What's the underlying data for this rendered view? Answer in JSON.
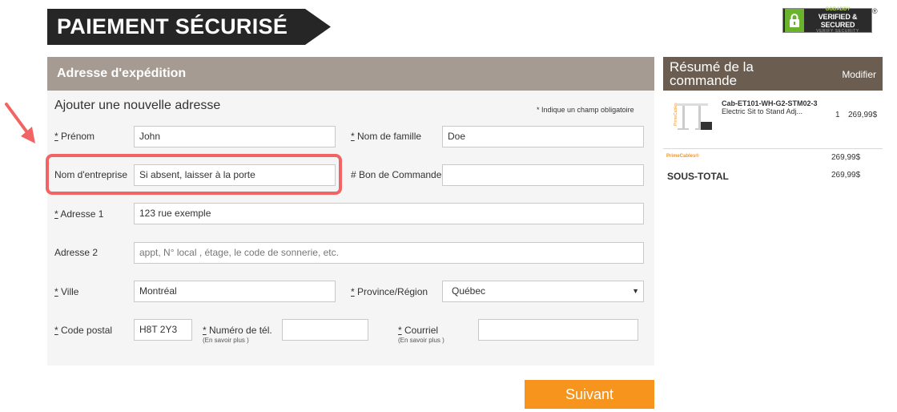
{
  "header": {
    "title": "PAIEMENT SÉCURISÉ",
    "badge": {
      "line1": "GODADDY",
      "line2": "VERIFIED & SECURED",
      "line3": "VERIFY SECURITY",
      "reg": "®"
    }
  },
  "shipping": {
    "heading": "Adresse d'expédition",
    "subtitle": "Ajouter une nouvelle adresse",
    "required_note": "* Indique un champ obligatoire",
    "fields": {
      "first_name": {
        "label": "Prénom",
        "value": "John"
      },
      "last_name": {
        "label": "Nom de famille",
        "value": "Doe"
      },
      "company": {
        "label": "Nom d'entreprise",
        "value": "Si absent, laisser à la porte"
      },
      "po_number": {
        "label": "# Bon de Commande",
        "value": ""
      },
      "address1": {
        "label": "Adresse 1",
        "value": "123 rue exemple"
      },
      "address2": {
        "label": "Adresse 2",
        "placeholder": "appt, N° local , étage, le code de sonnerie, etc."
      },
      "city": {
        "label": "Ville",
        "value": "Montréal"
      },
      "province": {
        "label": "Province/Région",
        "value": "Québec"
      },
      "postal": {
        "label": "Code postal",
        "value": "H8T 2Y3"
      },
      "phone": {
        "label": "Numéro de tél.",
        "hint": "(En savoir plus )",
        "value": ""
      },
      "email": {
        "label": "Courriel",
        "hint": "(En savoir plus )",
        "value": ""
      }
    },
    "required_marker": "*",
    "next_button": "Suivant"
  },
  "summary": {
    "title": "Résumé de la commande",
    "edit": "Modifier",
    "product": {
      "brand": "PrimeCables",
      "sku": "Cab-ET101-WH-G2-STM02-3",
      "name": "Electric Sit to Stand Adj...",
      "qty": "1",
      "price": "269,99$"
    },
    "brand_line": "PrimeCables®",
    "line_price": "269,99$",
    "subtotal_label": "SOUS-TOTAL",
    "subtotal": "269,99$"
  },
  "colors": {
    "banner": "#262626",
    "panel_header": "#a59b92",
    "summary_header": "#6b5d50",
    "accent_button": "#f7941d",
    "highlight": "#f26464"
  }
}
